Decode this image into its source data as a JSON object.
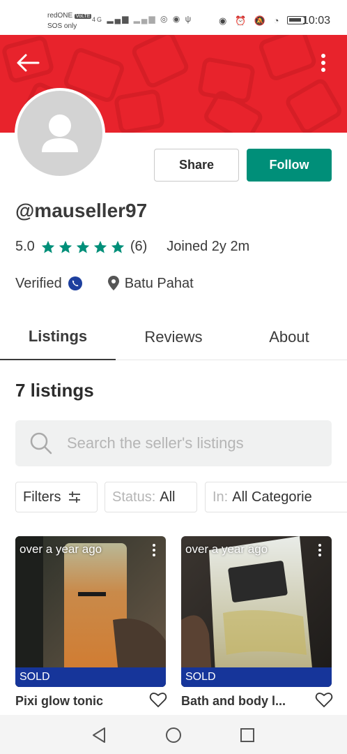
{
  "status_bar": {
    "carrier": "redONE",
    "carrier_badge": "VoLTE",
    "sos": "SOS only",
    "network": "4G",
    "time": "10:03"
  },
  "header": {
    "back_icon": "arrow-left-icon",
    "more_icon": "more-vert-icon",
    "banner_color": "#e8232c"
  },
  "actions": {
    "share_label": "Share",
    "follow_label": "Follow",
    "follow_color": "#008f79"
  },
  "profile": {
    "username": "@mauseller97",
    "rating": "5.0",
    "rating_stars": 5,
    "review_count": "(6)",
    "joined": "Joined 2y 2m",
    "verified_label": "Verified",
    "location": "Batu Pahat"
  },
  "tabs": [
    {
      "label": "Listings",
      "active": true
    },
    {
      "label": "Reviews",
      "active": false
    },
    {
      "label": "About",
      "active": false
    }
  ],
  "listings": {
    "count_label": "7 listings",
    "search_placeholder": "Search the seller's listings",
    "filters_label": "Filters",
    "status_prefix": "Status:",
    "status_value": "All",
    "category_prefix": "In:",
    "category_value": "All Categorie"
  },
  "items": [
    {
      "time": "over a year ago",
      "badge": "SOLD",
      "title": "Pixi glow tonic"
    },
    {
      "time": "over a year ago",
      "badge": "SOLD",
      "title": "Bath and body l..."
    }
  ],
  "colors": {
    "sold_badge": "#16359a",
    "star": "#008f79"
  }
}
